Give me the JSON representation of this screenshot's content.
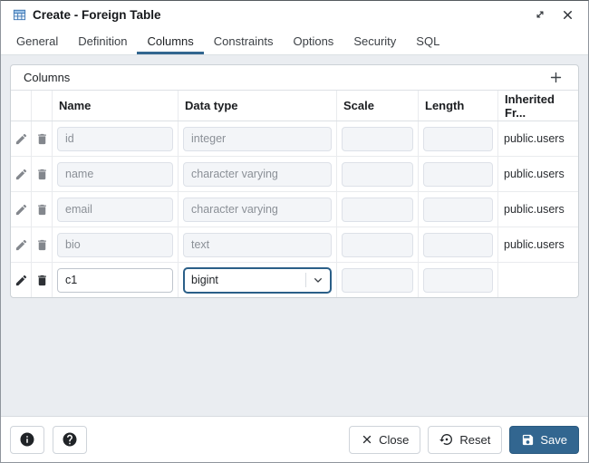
{
  "window": {
    "title": "Create - Foreign Table"
  },
  "tabs": [
    {
      "label": "General"
    },
    {
      "label": "Definition"
    },
    {
      "label": "Columns"
    },
    {
      "label": "Constraints"
    },
    {
      "label": "Options"
    },
    {
      "label": "Security"
    },
    {
      "label": "SQL"
    }
  ],
  "active_tab": "Columns",
  "columns_panel": {
    "title": "Columns"
  },
  "grid": {
    "headers": {
      "name": "Name",
      "data_type": "Data type",
      "scale": "Scale",
      "length": "Length",
      "inherited_from": "Inherited Fr..."
    },
    "rows": [
      {
        "name": "id",
        "data_type": "integer",
        "scale": "",
        "length": "",
        "inherited_from": "public.users"
      },
      {
        "name": "name",
        "data_type": "character varying",
        "scale": "",
        "length": "",
        "inherited_from": "public.users"
      },
      {
        "name": "email",
        "data_type": "character varying",
        "scale": "",
        "length": "",
        "inherited_from": "public.users"
      },
      {
        "name": "bio",
        "data_type": "text",
        "scale": "",
        "length": "",
        "inherited_from": "public.users"
      },
      {
        "name": "c1",
        "data_type": "bigint",
        "scale": "",
        "length": "",
        "inherited_from": ""
      }
    ]
  },
  "footer": {
    "close": "Close",
    "reset": "Reset",
    "save": "Save"
  },
  "colors": {
    "accent": "#326690",
    "content_bg": "#eaedf1",
    "disabled_input_bg": "#f3f5f8"
  }
}
